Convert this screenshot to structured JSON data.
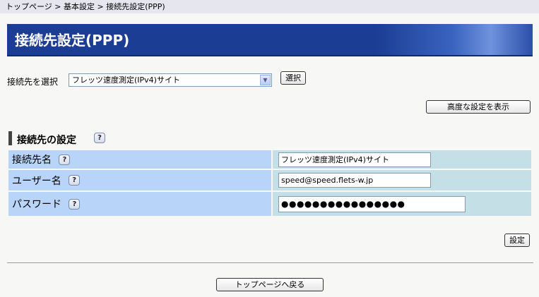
{
  "breadcrumb": {
    "text": "トップページ > 基本設定 > 接続先設定(PPP)"
  },
  "page": {
    "title": "接続先設定(PPP)"
  },
  "selector": {
    "label": "接続先を選択",
    "selected": "フレッツ速度測定(IPv4)サイト",
    "button": "選択"
  },
  "advanced_button": "高度な設定を表示",
  "section": {
    "title": "接続先の設定",
    "help": "?"
  },
  "form": {
    "rows": [
      {
        "label": "接続先名",
        "help": "?",
        "value": "フレッツ速度測定(IPv4)サイト"
      },
      {
        "label": "ユーザー名",
        "help": "?",
        "value": "speed@speed.flets-w.jp"
      },
      {
        "label": "パスワード",
        "help": "?",
        "value": "●●●●●●●●●●●●●●●●"
      }
    ]
  },
  "set_button": "設定",
  "back_button": "トップページへ戻る",
  "colors": {
    "title_bg": "#1b3d93",
    "label_cell": "#b8d4f8",
    "value_cell": "#c5dfe6",
    "breadcrumb_bg": "#e6e6ee"
  }
}
